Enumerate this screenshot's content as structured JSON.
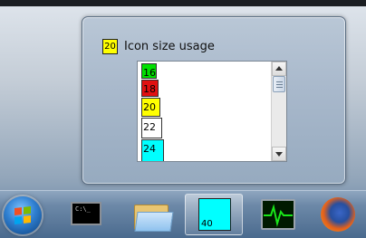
{
  "popup": {
    "icon_value": "20",
    "title": "Icon size usage",
    "list_items": [
      {
        "label": "16",
        "color": "#00e000"
      },
      {
        "label": "18",
        "color": "#e01010"
      },
      {
        "label": "20",
        "color": "#ffff00"
      },
      {
        "label": "22",
        "color": "#ffffff"
      },
      {
        "label": "24",
        "color": "#00ffff"
      }
    ]
  },
  "taskbar": {
    "buttons": [
      {
        "name": "start-button",
        "icon": "windows-logo-icon"
      },
      {
        "name": "cmd",
        "icon": "command-prompt-icon",
        "text": "C:\\_"
      },
      {
        "name": "explorer",
        "icon": "folder-icon"
      },
      {
        "name": "icon-size-app",
        "icon": "cyan-square-icon",
        "label": "40"
      },
      {
        "name": "resource-monitor",
        "icon": "pulse-monitor-icon"
      },
      {
        "name": "firefox",
        "icon": "firefox-icon"
      }
    ]
  }
}
